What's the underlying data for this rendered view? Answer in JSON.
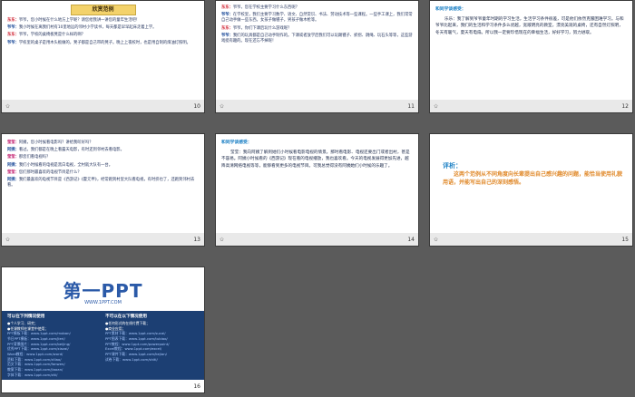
{
  "slides": [
    {
      "number": "10",
      "title": "欣赏范例",
      "lines": [
        {
          "speaker": "东东：",
          "text": "爷爷，您小时候在什么地方上学呢？请您给我讲一讲您的童年生活吧！",
          "color": "red"
        },
        {
          "speaker": "爷爷：",
          "text": "我小时候在离我们村有10里地远的邻村小学读书，每天都是早早起床走着上学。",
          "color": "blue"
        },
        {
          "speaker": "东东：",
          "text": "爷爷，学校的桌椅板凳是什么样的啊？",
          "color": "red"
        },
        {
          "speaker": "爷爷：",
          "text": "学校里的桌子是用木头板做的，凳子都是自己带的凳子。晚上上夜校时，也是用自制的煤油灯照明。",
          "color": "blue"
        }
      ]
    },
    {
      "number": "11",
      "lines": [
        {
          "speaker": "东东：",
          "text": "爷爷，您在学校主要学习什么东西呢？",
          "color": "red"
        },
        {
          "speaker": "爷爷：",
          "text": "在学校里，我们主要学习数学、语文、自然常识、书法、劳动技术等一些课程。一些手工课上，我们常常自己动手做一些东西。女孩子做毽子，男孩子做木枪等。",
          "color": "blue"
        },
        {
          "speaker": "东东：",
          "text": "爷爷，你们下课后玩什么游戏呢？",
          "color": "red"
        },
        {
          "speaker": "爷爷：",
          "text": "我们的玩具都是自己动手制作的。下课或者放学后我们可以玩踢毽子、抓拐、跳绳、玩石头等等，这些游戏挺有趣的。现在还忘不掉呢！",
          "color": "blue"
        }
      ]
    },
    {
      "number": "12",
      "share_title": "和同学谈感受：",
      "share_text": "乐乐：我了解到爷爷童年时期的学习生活，生活学习条件很差，可是他们依然克服困难学习。与和爷爷比起来，我们的生活和学习条件多么优越，宽敞明亮的教室，漂亮美观的桌椅，还有自然灯照明，冬天有暖气，夏天有电扇。所以我一定要珍惜现在的幸福生活，好好学习，努力进取。"
    },
    {
      "number": "13",
      "lines": [
        {
          "speaker": "莹莹：",
          "text": "阿姨，您小时候看电影吗？讲给我听好吗？",
          "color": "magenta"
        },
        {
          "speaker": "阿姨：",
          "text": "看过。我们都是在晚上看露天电影，有时还到邻村去看电影。",
          "color": "blue"
        },
        {
          "speaker": "莹莹：",
          "text": "那您们看电视吗？",
          "color": "magenta"
        },
        {
          "speaker": "阿姨：",
          "text": "我们小时候看的电视是黑白电视，全村就大队有一台。",
          "color": "blue"
        },
        {
          "speaker": "莹莹：",
          "text": "您们那时最喜欢的电视节目是什么？",
          "color": "magenta"
        },
        {
          "speaker": "阿姨：",
          "text": "我们最喜欢的电视节目是《西游记》《霍元甲》，经常跑到村里大队看电视，有时挤也了，还跑到邻村去看。",
          "color": "blue"
        }
      ]
    },
    {
      "number": "14",
      "share_title": "和同学谈感受：",
      "share_text": "莹莹：我向阿姨了解到她们小时候看电影电视的情景。那时看电影、电视还要出门或者出村，甚是不容易。阿姨小时候看的《西游记》现在看的电视播放，我也喜欢看。今天的电视发展得更加先进，越降高清网络电视等等，能够看到更多的电视节目。可我总觉得没有阿姨她们小时候的乐趣了。"
    },
    {
      "number": "15",
      "eval_title": "评析：",
      "eval_text": "这两个范例从不同角度向长辈提出自己感兴趣的问题，能恰当使用礼貌用语，并能写出自己的深刻感悟。"
    },
    {
      "number": "16",
      "logo": "第一PPT",
      "url": "WWW.1PPT.COM",
      "col1_head": "可以在下列情况使用",
      "col1_items": [
        "●个人学习、研究；",
        "●任课教师在课堂中使用；",
        "PPT模板下载：www.1ppt.com/moban/",
        "节日PPT模板：www.1ppt.com/jieri/",
        "PPT背景图片：www.1ppt.com/beijing/",
        "优秀PPT下载：www.1ppt.com/xiazai/",
        "Word教程：www.1ppt.com/word/",
        "资料下载：www.1ppt.com/ziliao/",
        "范文下载：www.1ppt.com/fanwen/",
        "教案下载：www.1ppt.com/jiaoan/",
        "字体下载：www.1ppt.com/ziti/"
      ],
      "col2_head": "不可以在以下情况使用",
      "col2_items": [
        "●任何形式的在线付费下载；",
        "●商业应用；",
        "PPT素材下载：www.1ppt.com/sucai/",
        "PPT图表下载：www.1ppt.com/tubiao/",
        "PPT教程：www.1ppt.com/powerpoint/",
        "Excel教程：www.1ppt.com/excel/",
        "PPT课件下载：www.1ppt.com/kejian/",
        "试卷下载：www.1ppt.com/shiti/"
      ]
    }
  ],
  "colors": {
    "red": "#d0202f",
    "blue": "#214f9c",
    "magenta": "#c21c6e",
    "share_title": "#1a7fc4",
    "eval_text": "#e0892a"
  }
}
